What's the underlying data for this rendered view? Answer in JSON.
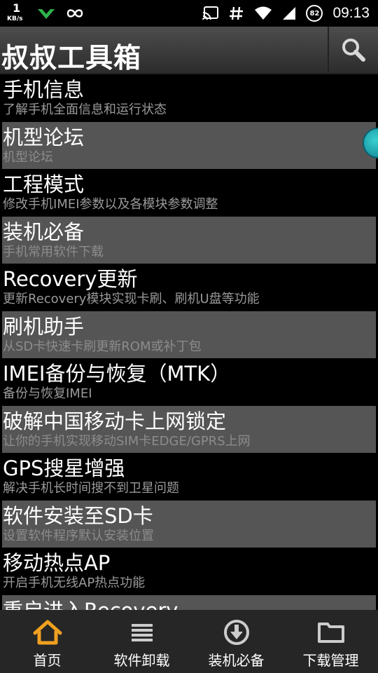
{
  "status_bar": {
    "speed_value": "1",
    "speed_unit": "KB/s",
    "battery": "82",
    "time": "09:13",
    "icons": [
      "download-icon",
      "infinity-icon",
      "cast-icon",
      "hash-icon",
      "wifi-icon",
      "signal-icon",
      "battery-icon"
    ]
  },
  "app": {
    "title": "叔叔工具箱",
    "search_icon": "search-icon"
  },
  "list": [
    {
      "title": "手机信息",
      "subtitle": "了解手机全面信息和运行状态"
    },
    {
      "title": "机型论坛",
      "subtitle": "机型论坛"
    },
    {
      "title": "工程模式",
      "subtitle": "修改手机IMEI参数以及各模块参数调整"
    },
    {
      "title": "装机必备",
      "subtitle": "手机常用软件下载"
    },
    {
      "title": "Recovery更新",
      "subtitle": "更新Recovery模块实现卡刷、刷机U盘等功能"
    },
    {
      "title": "刷机助手",
      "subtitle": "从SD卡快速卡刷更新ROM或补丁包"
    },
    {
      "title": "IMEI备份与恢复（MTK）",
      "subtitle": "备份与恢复IMEI"
    },
    {
      "title": "破解中国移动卡上网锁定",
      "subtitle": "让你的手机实现移动SIM卡EDGE/GPRS上网"
    },
    {
      "title": "GPS搜星增强",
      "subtitle": "解决手机长时间搜不到卫星问题"
    },
    {
      "title": "软件安装至SD卡",
      "subtitle": "设置软件程序默认安装位置"
    },
    {
      "title": "移动热点AP",
      "subtitle": "开启手机无线AP热点功能"
    },
    {
      "title": "重启进入Recovery",
      "subtitle": ""
    }
  ],
  "bottom_nav": [
    {
      "label": "首页",
      "icon": "home-icon",
      "active": true
    },
    {
      "label": "软件卸载",
      "icon": "list-icon",
      "active": false
    },
    {
      "label": "装机必备",
      "icon": "download-circle-icon",
      "active": false
    },
    {
      "label": "下载管理",
      "icon": "folder-icon",
      "active": false
    }
  ],
  "colors": {
    "active_tab": "#f0a020",
    "row_light": "#555555",
    "row_dark": "#000000",
    "subtitle": "#9a9a9a"
  }
}
